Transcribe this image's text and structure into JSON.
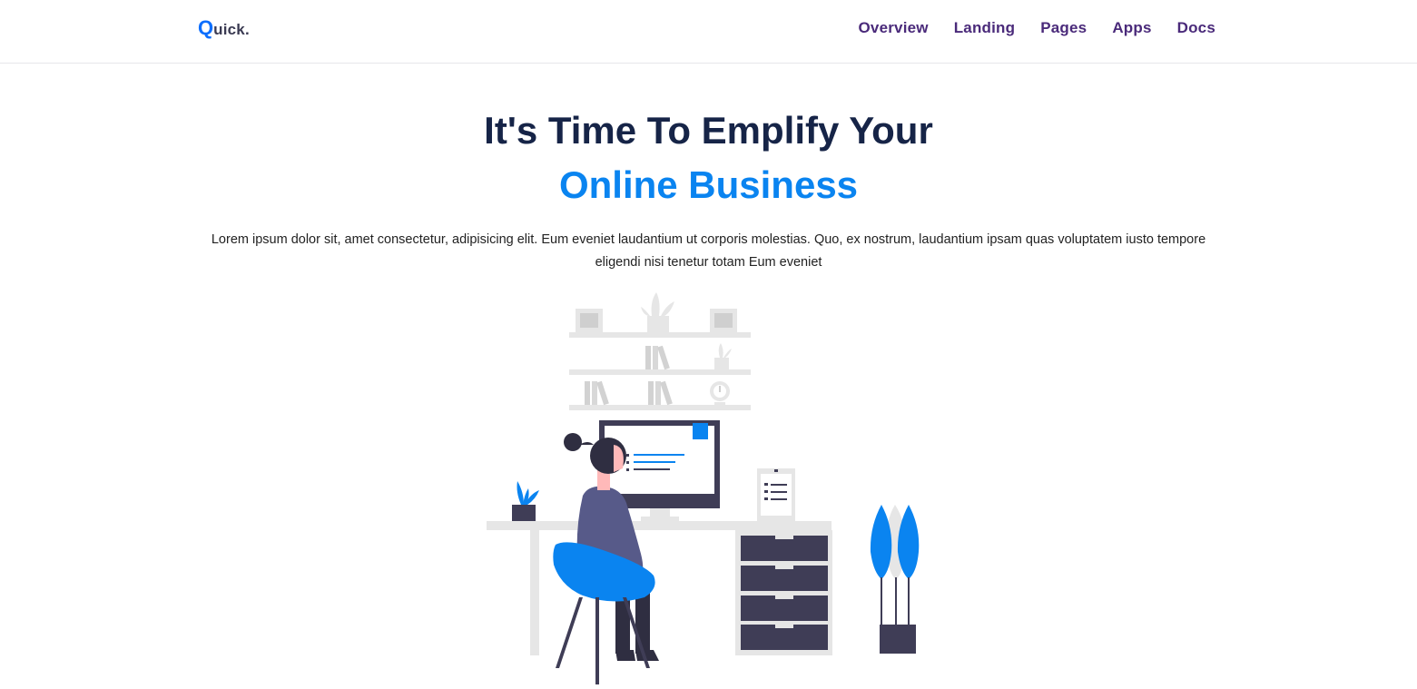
{
  "brand": {
    "logo_q": "Q",
    "logo_rest": "uick."
  },
  "nav": {
    "items": [
      {
        "label": "Overview"
      },
      {
        "label": "Landing"
      },
      {
        "label": "Pages"
      },
      {
        "label": "Apps"
      },
      {
        "label": "Docs"
      }
    ]
  },
  "hero": {
    "title_line1": "It's Time To Emplify Your",
    "title_line2": "Online Business",
    "description": "Lorem ipsum dolor sit, amet consectetur, adipisicing elit. Eum eveniet laudantium ut corporis molestias. Quo, ex nostrum, laudantium ipsam quas voluptatem iusto tempore eligendi nisi tenetur totam Eum eveniet"
  },
  "colors": {
    "brand_blue": "#0a84f0",
    "heading_navy": "#162447",
    "nav_purple": "#4a2a7a",
    "dark_slate": "#3f3d56",
    "light_gray": "#e6e6e6"
  },
  "illustration": {
    "icon": "woman-at-desk-illustration"
  }
}
